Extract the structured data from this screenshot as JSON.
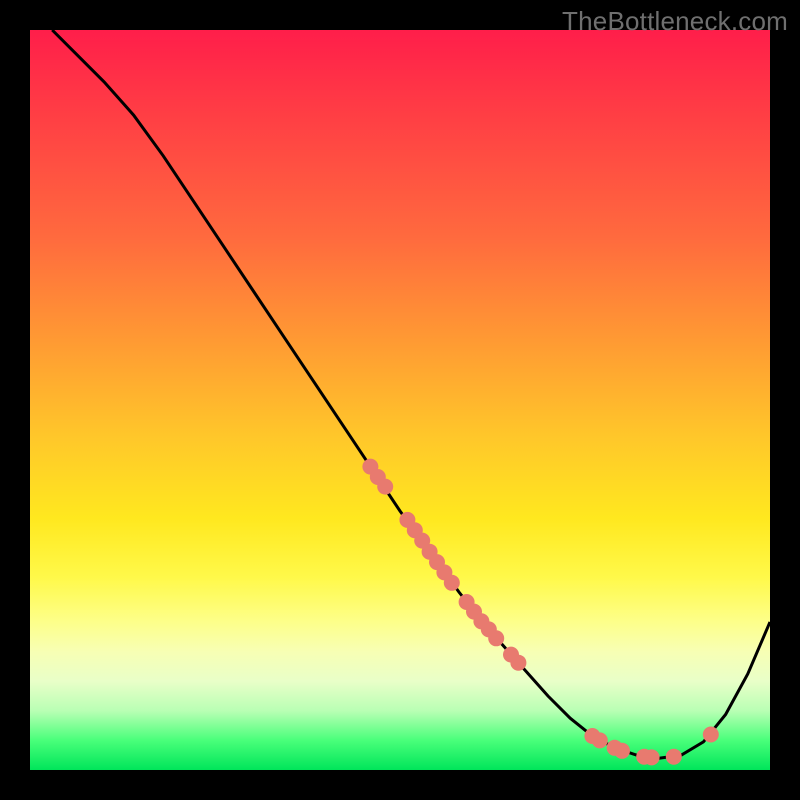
{
  "watermark": "TheBottleneck.com",
  "colors": {
    "curve": "#000000",
    "dot_fill": "#e87a6f",
    "dot_stroke": "#c76056"
  },
  "chart_data": {
    "type": "line",
    "title": "",
    "xlabel": "",
    "ylabel": "",
    "xlim": [
      0,
      100
    ],
    "ylim": [
      0,
      100
    ],
    "series": [
      {
        "name": "curve",
        "x": [
          3,
          6,
          10,
          14,
          18,
          22,
          26,
          30,
          34,
          38,
          42,
          46,
          50,
          54,
          58,
          62,
          66,
          70,
          73,
          76,
          79,
          82,
          85,
          88,
          91,
          94,
          97,
          100
        ],
        "y": [
          100,
          97,
          93,
          88.5,
          83,
          77,
          71,
          65,
          59,
          53,
          47,
          41,
          35,
          29.5,
          24,
          19,
          14.5,
          10,
          7,
          4.6,
          3,
          2,
          1.6,
          2,
          3.8,
          7.5,
          13,
          20
        ]
      }
    ],
    "cluster_dots_on_curve": [
      {
        "x": 46,
        "y": 41
      },
      {
        "x": 47,
        "y": 39.6
      },
      {
        "x": 48,
        "y": 38.3
      },
      {
        "x": 51,
        "y": 33.8
      },
      {
        "x": 52,
        "y": 32.4
      },
      {
        "x": 53,
        "y": 31.0
      },
      {
        "x": 54,
        "y": 29.5
      },
      {
        "x": 55,
        "y": 28.1
      },
      {
        "x": 56,
        "y": 26.7
      },
      {
        "x": 57,
        "y": 25.3
      },
      {
        "x": 59,
        "y": 22.7
      },
      {
        "x": 60,
        "y": 21.4
      },
      {
        "x": 61,
        "y": 20.1
      },
      {
        "x": 62,
        "y": 19.0
      },
      {
        "x": 63,
        "y": 17.8
      },
      {
        "x": 65,
        "y": 15.6
      },
      {
        "x": 66,
        "y": 14.5
      },
      {
        "x": 76,
        "y": 4.6
      },
      {
        "x": 77,
        "y": 4.0
      },
      {
        "x": 79,
        "y": 3.0
      },
      {
        "x": 80,
        "y": 2.6
      },
      {
        "x": 83,
        "y": 1.8
      },
      {
        "x": 84,
        "y": 1.7
      },
      {
        "x": 87,
        "y": 1.8
      },
      {
        "x": 92,
        "y": 4.8
      }
    ],
    "dot_radius_px": 8
  }
}
